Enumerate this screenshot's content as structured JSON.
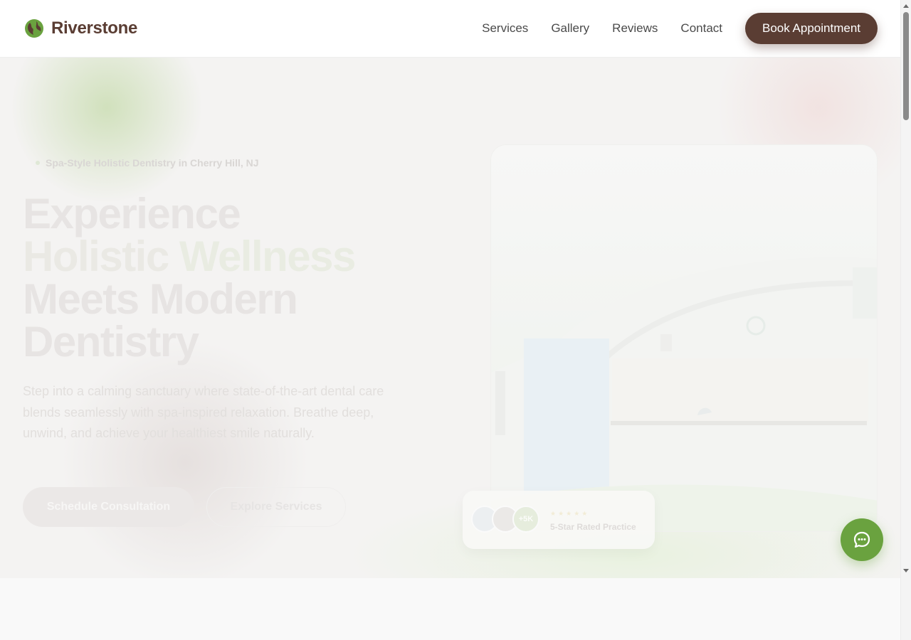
{
  "header": {
    "brand_name": "Riverstone",
    "logo_icon": "leaf-globe-icon",
    "nav": [
      {
        "label": "Services"
      },
      {
        "label": "Gallery"
      },
      {
        "label": "Reviews"
      },
      {
        "label": "Contact"
      }
    ],
    "cta_label": "Book Appointment"
  },
  "hero": {
    "eyebrow": "Spa-Style Holistic Dentistry in Cherry Hill, NJ",
    "headline": {
      "line1": "Experience",
      "line2_a": "Holistic ",
      "line2_b": "Wellness",
      "line3": "Meets Modern",
      "line4": "Dentistry"
    },
    "lead": "Step into a calming sanctuary where state-of-the-art dental care blends seamlessly with spa-inspired relaxation. Breathe deep, unwind, and achieve your healthiest smile naturally.",
    "primary_cta": "Schedule Consultation",
    "secondary_cta": "Explore Services",
    "photo_icon": "dental-office-photo",
    "rating": {
      "badge": "+5K",
      "stars": "★★★★★",
      "label": "5-Star Rated Practice"
    }
  },
  "chat": {
    "icon": "chat-bubble-icon"
  },
  "colors": {
    "brand_brown": "#5a3d33",
    "accent_green": "#6aa23f"
  }
}
